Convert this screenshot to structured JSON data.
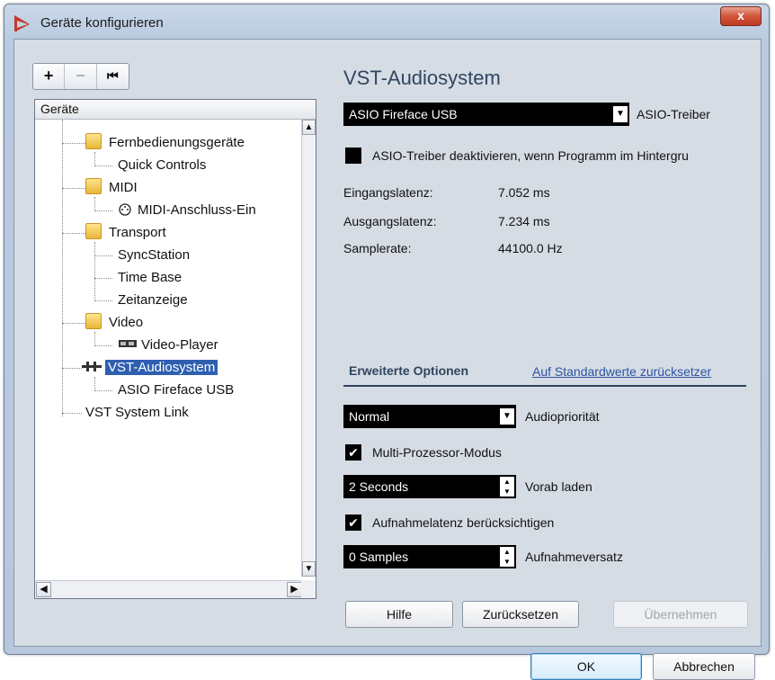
{
  "window": {
    "title": "Geräte konfigurieren",
    "close_glyph": "x"
  },
  "toolbar": {
    "add_glyph": "+",
    "remove_glyph": "−",
    "reset_glyph": "⏮"
  },
  "tree": {
    "header": "Geräte",
    "items": [
      {
        "label": "Fernbedienungsgeräte",
        "icon": "folder-icon"
      },
      {
        "label": "Quick Controls"
      },
      {
        "label": "MIDI",
        "icon": "folder-icon"
      },
      {
        "label": "MIDI-Anschluss-Ein",
        "icon": "midi-port-icon"
      },
      {
        "label": "Transport",
        "icon": "folder-icon"
      },
      {
        "label": "SyncStation"
      },
      {
        "label": "Time Base"
      },
      {
        "label": "Zeitanzeige"
      },
      {
        "label": "Video",
        "icon": "folder-icon"
      },
      {
        "label": "Video-Player",
        "icon": "video-player-icon"
      },
      {
        "label": "VST-Audiosystem",
        "icon": "vst-audio-icon",
        "selected": true
      },
      {
        "label": "ASIO Fireface USB"
      },
      {
        "label": "VST System Link"
      }
    ]
  },
  "panel": {
    "title": "VST-Audiosystem",
    "driver": {
      "value": "ASIO Fireface USB",
      "label": "ASIO-Treiber"
    },
    "deactivate_label": "ASIO-Treiber deaktivieren, wenn Programm im Hintergru",
    "deactivate_checked": false,
    "info": [
      {
        "label": "Eingangslatenz:",
        "value": "7.052 ms"
      },
      {
        "label": "Ausgangslatenz:",
        "value": "7.234 ms"
      },
      {
        "label": "Samplerate:",
        "value": "44100.0 Hz"
      }
    ],
    "advanced_tab": "Erweiterte Optionen",
    "reset_defaults_link": "Auf Standardwerte zurücksetzer",
    "priority": {
      "value": "Normal",
      "label": "Audiopriorität"
    },
    "multiprocessor": {
      "label": "Multi-Prozessor-Modus",
      "checked": true
    },
    "preload": {
      "value": "2 Seconds",
      "label": "Vorab laden"
    },
    "rec_latency": {
      "label": "Aufnahmelatenz berücksichtigen",
      "checked": true
    },
    "rec_offset": {
      "value": "0 Samples",
      "label": "Aufnahmeversatz"
    }
  },
  "buttons": {
    "help": "Hilfe",
    "reset": "Zurücksetzen",
    "apply": "Übernehmen",
    "ok": "OK",
    "cancel": "Abbrechen"
  },
  "colors": {
    "accent": "#2f5fb0",
    "title_text": "#2f4560",
    "link": "#2b55a4"
  }
}
